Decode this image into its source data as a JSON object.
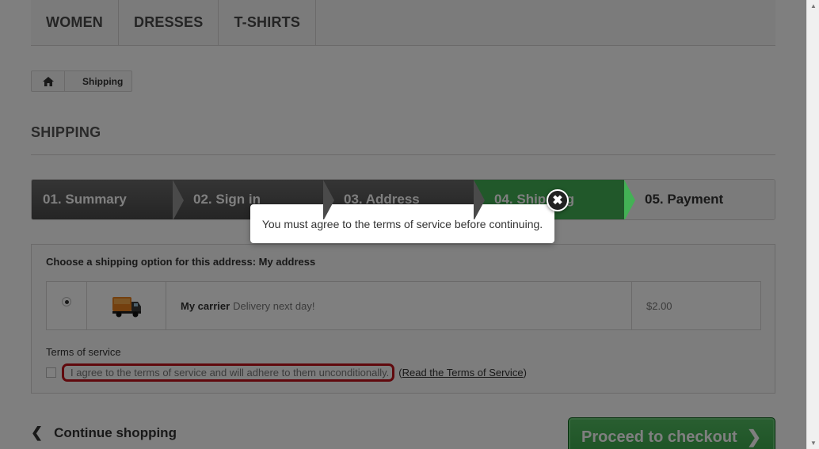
{
  "top_menu": {
    "items": [
      {
        "label": "WOMEN"
      },
      {
        "label": "DRESSES"
      },
      {
        "label": "T-SHIRTS"
      }
    ]
  },
  "breadcrumb": {
    "home_icon": "home-icon",
    "current": "Shipping"
  },
  "page": {
    "title": "SHIPPING"
  },
  "steps": [
    {
      "label": "01. Summary",
      "state": "done"
    },
    {
      "label": "02. Sign in",
      "state": "done"
    },
    {
      "label": "03. Address",
      "state": "done"
    },
    {
      "label": "04. Shipping",
      "state": "current"
    },
    {
      "label": "05. Payment",
      "state": "todo"
    }
  ],
  "shipping": {
    "option_label": "Choose a shipping option for this address: My address",
    "carrier": {
      "name": "My carrier",
      "description": "Delivery next day!",
      "price": "$2.00",
      "selected": true,
      "image_icon": "truck-icon"
    },
    "tos_title": "Terms of service",
    "tos_agree_text": "I agree to the terms of service and will adhere to them unconditionally.",
    "tos_link_text": "(Read the Terms of Service)",
    "tos_link_open": "(",
    "tos_link_label": "Read the Terms of Service",
    "tos_link_close": ")"
  },
  "footer": {
    "continue_label": "Continue shopping",
    "checkout_label": "Proceed to checkout"
  },
  "modal": {
    "message": "You must agree to the terms of service before continuing.",
    "close_icon": "close-icon"
  },
  "colors": {
    "current_step": "#43b155",
    "done_step": "#555555",
    "error_outline": "#c0121b",
    "overlay": "rgba(0,0,0,0.5)"
  }
}
